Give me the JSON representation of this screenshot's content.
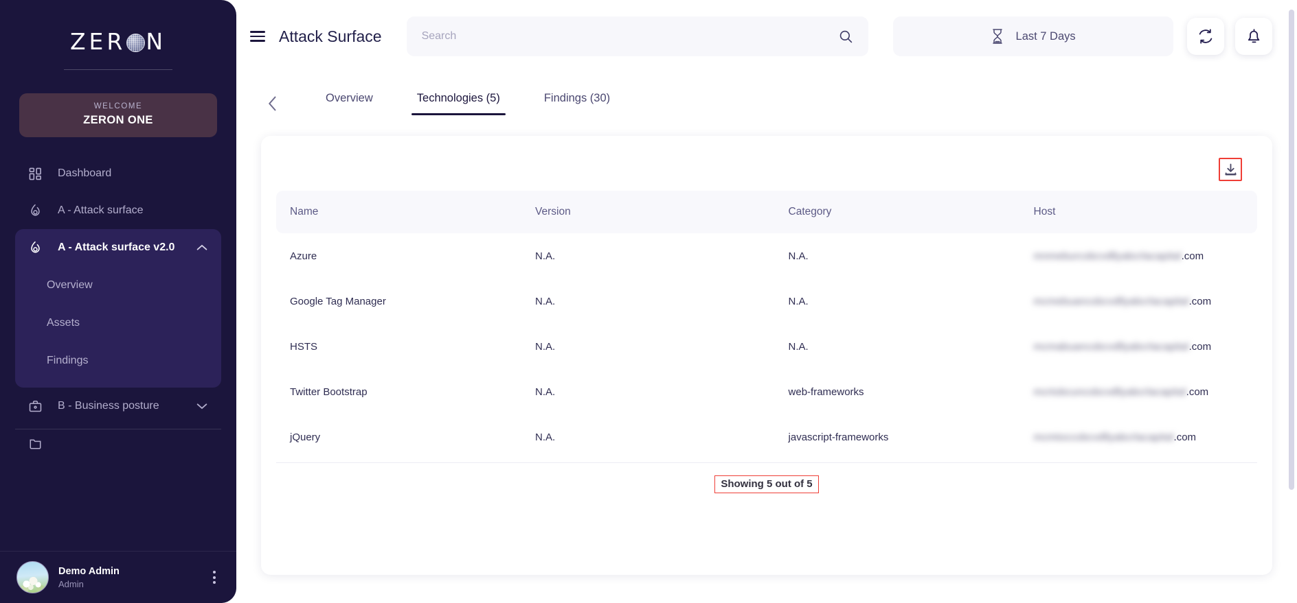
{
  "brand": {
    "logo_left": "ZER",
    "logo_right": "N",
    "globe_icon": "globe-icon",
    "welcome_label": "WELCOME",
    "org_name": "ZERON ONE"
  },
  "colors": {
    "sidebar_bg": "#1b153c",
    "sidebar_active": "#2c2259",
    "welcome_card": "#493246",
    "accent_annotation": "#ef3e36",
    "text_dark": "#1b153c",
    "panel_light": "#f7f7fb"
  },
  "sidebar": {
    "items": [
      {
        "label": "Dashboard",
        "icon": "grid-dashboard-icon",
        "type": "link",
        "active": false
      },
      {
        "label": "A - Attack surface",
        "icon": "flame-icon",
        "type": "link",
        "active": false
      },
      {
        "label": "A - Attack surface v2.0",
        "icon": "flame-icon",
        "type": "group",
        "active": true,
        "chevron": "chevron-up-icon"
      },
      {
        "label": "B - Business posture",
        "icon": "briefcase-icon",
        "type": "group",
        "active": false,
        "chevron": "chevron-down-icon"
      }
    ],
    "sub_items": [
      {
        "label": "Overview"
      },
      {
        "label": "Assets"
      },
      {
        "label": "Findings"
      }
    ],
    "user": {
      "name": "Demo Admin",
      "role": "Admin",
      "avatar": "user-avatar-photo",
      "menu_icon": "kebab-menu-icon"
    }
  },
  "topbar": {
    "menu_icon": "hamburger-menu-icon",
    "title": "Attack Surface",
    "search": {
      "value": "",
      "placeholder": "Search",
      "icon": "search-icon"
    },
    "date_range": {
      "label": "Last 7 Days",
      "icon": "hourglass-icon"
    },
    "refresh": {
      "icon": "refresh-icon"
    },
    "notifications": {
      "icon": "bell-icon"
    }
  },
  "tabs": {
    "back_icon": "chevron-left-icon",
    "items": [
      {
        "label": "Overview",
        "active": false
      },
      {
        "label": "Technologies (5)",
        "active": true
      },
      {
        "label": "Findings (30)",
        "active": false
      }
    ]
  },
  "card": {
    "download_button": {
      "icon": "download-icon",
      "label": "Download"
    },
    "table": {
      "columns": [
        "Name",
        "Version",
        "Category",
        "Host"
      ],
      "rows": [
        {
          "name": "Azure",
          "version": "N.A.",
          "category": "N.A.",
          "host_redacted": "mnmeburcobcvdllyabcrlacapital",
          "host_tld": ".com"
        },
        {
          "name": "Google Tag Manager",
          "version": "N.A.",
          "category": "N.A.",
          "host_redacted": "mcmebuancobcvdllyabcrlacapital",
          "host_tld": ".com"
        },
        {
          "name": "HSTS",
          "version": "N.A.",
          "category": "N.A.",
          "host_redacted": "mcmabuancobcvdllyabcrlacapital",
          "host_tld": ".com"
        },
        {
          "name": "Twitter Bootstrap",
          "version": "N.A.",
          "category": "web-frameworks",
          "host_redacted": "mcrtobcuncobcvdllyabcrlacapital",
          "host_tld": ".com"
        },
        {
          "name": "jQuery",
          "version": "N.A.",
          "category": "javascript-frameworks",
          "host_redacted": "mcmtoccobcvdllyabcrlacapital",
          "host_tld": ".com"
        }
      ]
    },
    "footer": {
      "showing": "Showing 5 out of 5"
    }
  }
}
